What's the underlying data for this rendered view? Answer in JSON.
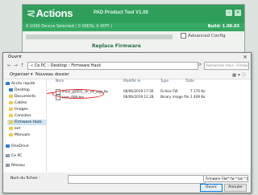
{
  "app": {
    "logo": "Actions",
    "title": "PAD Product Tool V1.00",
    "status_left": "0-1000 Device Selected ( 0 00DSL 0 4DTI )",
    "status_right": "Build: 1.00.03",
    "advanced_label": "Advanced Config",
    "section_label": "Replace Firmware"
  },
  "dialog": {
    "title": "Ouvrir",
    "address": "« Ce PC  ›  Desktop  ›  Firmware Hack",
    "search_placeholder": "Rechercher dans : Firmware Hack",
    "toolbar": {
      "organize": "Organiser ▾",
      "new_folder": "Nouveau dossier"
    },
    "sidebar": [
      {
        "label": "Accès rapide",
        "icon": "star-icon"
      },
      {
        "label": "Desktop",
        "icon": "folder-icon"
      },
      {
        "label": "Documents",
        "icon": "folder-icon"
      },
      {
        "label": "Cables",
        "icon": "folder-icon"
      },
      {
        "label": "Images",
        "icon": "folder-icon"
      },
      {
        "label": "Consoles",
        "icon": "folder-icon"
      },
      {
        "label": "Firmware Hack",
        "icon": "folder-icon"
      },
      {
        "label": "ext",
        "icon": "folder-icon"
      },
      {
        "label": "Manuals",
        "icon": "folder-icon"
      },
      {
        "label": "OneDrive",
        "icon": "cloud-icon"
      },
      {
        "label": "Ce PC",
        "icon": "pc-icon"
      },
      {
        "label": "Réseau",
        "icon": "network-icon"
      }
    ],
    "columns": {
      "name": "Nom",
      "modified": "Modifié le",
      "type": "Type",
      "size": "Taille"
    },
    "files": [
      {
        "name": "linux_g5001_ch_v4_sign.fw",
        "modified": "06/06/2019 17:56",
        "type": "Fichier FW",
        "size": "7 170 Ko"
      },
      {
        "name": "user_008.bin",
        "modified": "06/06/2019 11:28",
        "type": "Binary image file",
        "size": "1 408 Ko"
      }
    ],
    "filename_label": "Nom du fichier :",
    "filename_value": "",
    "filetype": "Firmware File(*.fw *.bin *.firm)",
    "open_label": "Ouvrir",
    "cancel_label": "Annuler"
  }
}
